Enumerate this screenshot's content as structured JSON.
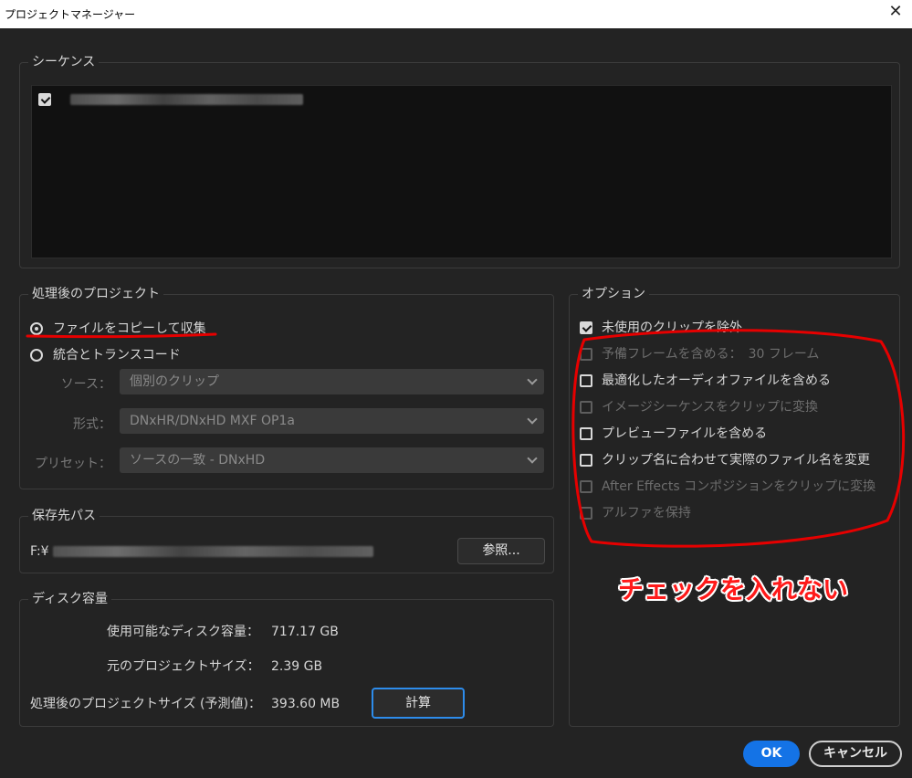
{
  "window": {
    "title": "プロジェクトマネージャー",
    "close_glyph": "✕"
  },
  "sequence": {
    "legend": "シーケンス",
    "item_checked": true
  },
  "project": {
    "legend": "処理後のプロジェクト",
    "radio_collect": "ファイルをコピーして収集",
    "radio_transcode": "統合とトランスコード",
    "selected": "collect",
    "source_label": "ソース：",
    "source_value": "個別のクリップ",
    "format_label": "形式：",
    "format_value": "DNxHR/DNxHD MXF OP1a",
    "preset_label": "プリセット：",
    "preset_value": "ソースの一致 - DNxHD"
  },
  "options": {
    "legend": "オプション",
    "items": [
      {
        "label": "未使用のクリップを除外",
        "checked": true,
        "disabled": false
      },
      {
        "label": "予備フレームを含める：　30 フレーム",
        "checked": false,
        "disabled": true
      },
      {
        "label": "最適化したオーディオファイルを含める",
        "checked": false,
        "disabled": false
      },
      {
        "label": "イメージシーケンスをクリップに変換",
        "checked": false,
        "disabled": true
      },
      {
        "label": "プレビューファイルを含める",
        "checked": false,
        "disabled": false
      },
      {
        "label": "クリップ名に合わせて実際のファイル名を変更",
        "checked": false,
        "disabled": false
      },
      {
        "label": "After Effects コンポジションをクリップに変換",
        "checked": false,
        "disabled": true
      },
      {
        "label": "アルファを保持",
        "checked": false,
        "disabled": true
      }
    ]
  },
  "destination": {
    "legend": "保存先パス",
    "path_prefix": "F:¥",
    "browse_label": "参照..."
  },
  "disk": {
    "legend": "ディスク容量",
    "available_label": "使用可能なディスク容量：",
    "available_value": "717.17 GB",
    "original_label": "元のプロジェクトサイズ：",
    "original_value": "2.39 GB",
    "resulting_label": "処理後のプロジェクトサイズ (予測値)：",
    "resulting_value": "393.60 MB",
    "calculate_label": "計算"
  },
  "footer": {
    "ok_label": "OK",
    "cancel_label": "キャンセル"
  },
  "annotation": {
    "text": "チェックを入れない",
    "color": "#ff1a1a"
  },
  "colors": {
    "accent": "#1473e6",
    "focus": "#2d8ceb",
    "background": "#232323"
  }
}
